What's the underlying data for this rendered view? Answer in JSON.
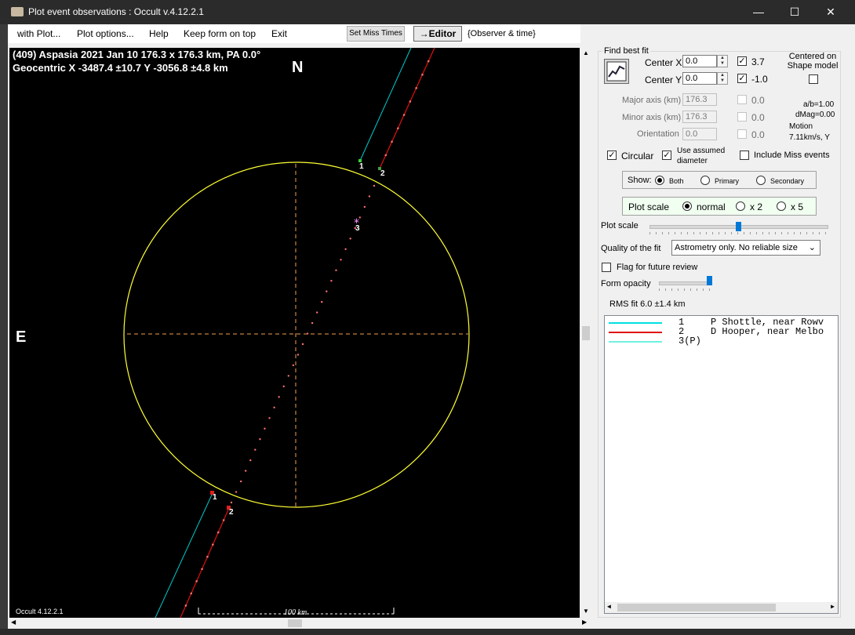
{
  "window": {
    "title": "Plot event observations : Occult v.4.12.2.1"
  },
  "menu": {
    "items": [
      "with Plot...",
      "Plot options...",
      "Help",
      "Keep form on top",
      "Exit"
    ],
    "miss_times_btn": "Set Miss Times",
    "editor_btn": "→Editor",
    "observer_time": "{Observer & time}"
  },
  "plot": {
    "line1": "(409) Aspasia  2021 Jan 10   176.3 x 176.3 km, PA 0.0°",
    "line2": "Geocentric  X  -3487.4 ±10.7  Y -3056.8 ±4.8 km",
    "north": "N",
    "east": "E",
    "scale_label": "100 km",
    "version_label": "Occult 4.12.2.1",
    "chord_labels": [
      "1",
      "2",
      "1",
      "2",
      "3"
    ],
    "colors": {
      "ellipse": "#ffff33",
      "chord1": "#00cccc",
      "chord2": "#e01010",
      "axes": "#f0a050"
    }
  },
  "panel": {
    "find_best_fit": "Find best fit",
    "center_x_label": "Center X",
    "center_x": "0.0",
    "center_y_label": "Center Y",
    "center_y": "0.0",
    "cb1_label": "3.7",
    "cb2_label": "-1.0",
    "centered_on": "Centered on Shape model",
    "major_label": "Major axis (km)",
    "major": "176.3",
    "major_cb": "0.0",
    "minor_label": "Minor axis (km)",
    "minor": "176.3",
    "minor_cb": "0.0",
    "orient_label": "Orientation",
    "orient": "0.0",
    "orient_cb": "0.0",
    "ab": "a/b=1.00",
    "dmag": "dMag=0.00",
    "motion": "Motion",
    "motion_val": "7.11km/s, Y",
    "circular": "Circular",
    "use_assumed": "Use assumed diameter",
    "include_miss": "Include Miss events",
    "show_label": "Show:",
    "show_opts": [
      "Both",
      "Primary",
      "Secondary"
    ],
    "plot_scale_label": "Plot scale",
    "scale_opts": [
      "normal",
      "x 2",
      "x 5"
    ],
    "plot_scale_slider_label": "Plot scale",
    "quality_label": "Quality of the fit",
    "quality_value": "Astrometry only. No reliable size",
    "flag_label": "Flag for future review",
    "opacity_label": "Form opacity",
    "rms": "RMS fit 6.0 ±1.4 km",
    "legend": [
      {
        "num": "1",
        "text": "P Shottle, near Rowv",
        "color": "#00e0e0"
      },
      {
        "num": "2",
        "text": "D Hooper, near Melbo",
        "color": "#e01010"
      },
      {
        "num": "3(P)",
        "text": "",
        "color": "#70f0e0"
      }
    ]
  }
}
